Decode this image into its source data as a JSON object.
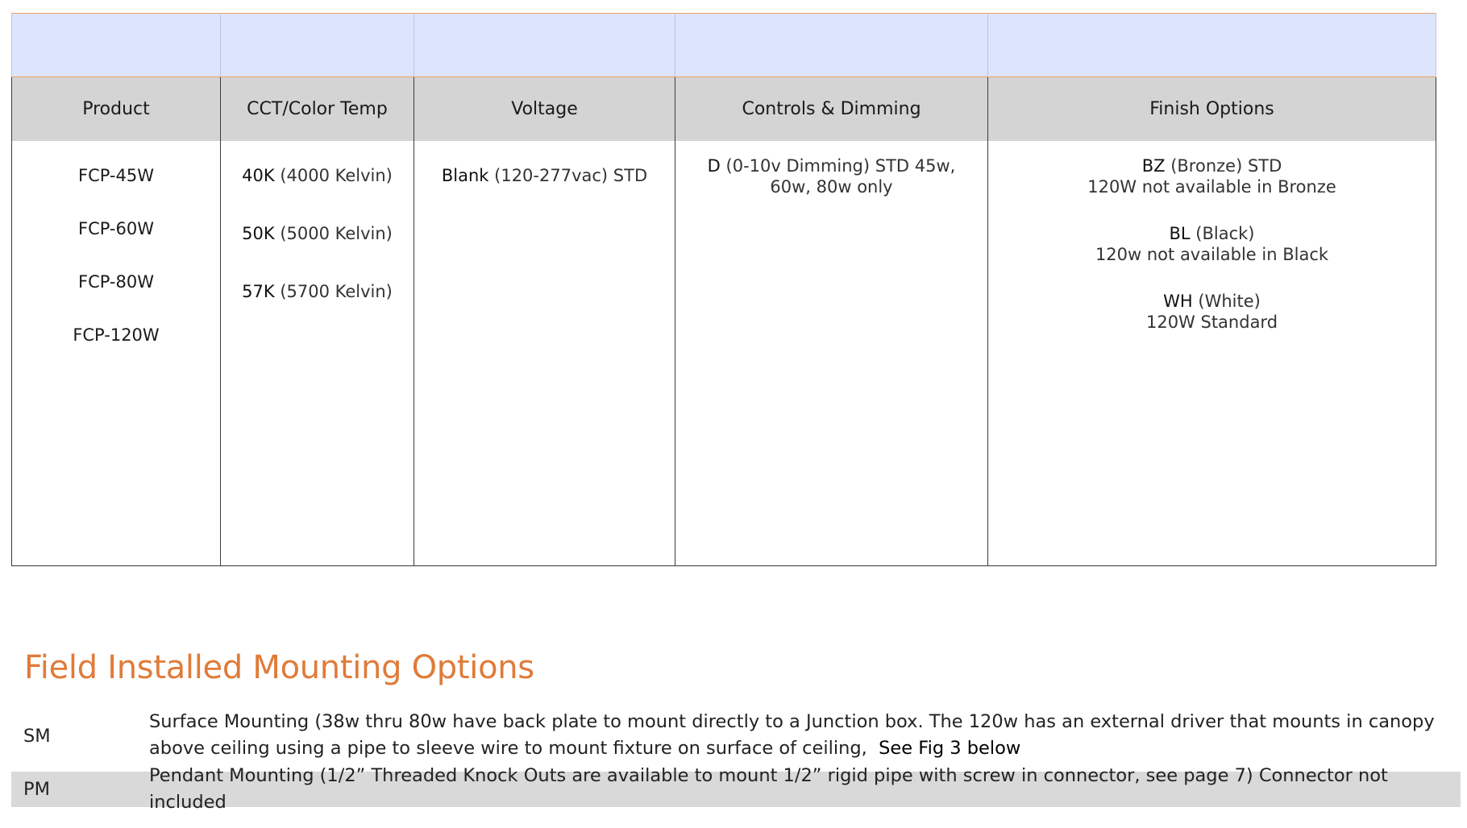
{
  "table": {
    "headers": [
      "Product",
      "CCT/Color Temp",
      "Voltage",
      "Controls & Dimming",
      "Finish Options"
    ],
    "products": [
      "FCP-45W",
      "FCP-60W",
      "FCP-80W",
      "FCP-120W"
    ],
    "cct": [
      {
        "code": "40K",
        "desc": "(4000 Kelvin)"
      },
      {
        "code": "50K",
        "desc": "(5000 Kelvin)"
      },
      {
        "code": "57K",
        "desc": "(5700 Kelvin)"
      }
    ],
    "voltage": {
      "code": "Blank",
      "desc": "(120-277vac) STD"
    },
    "controls": {
      "code": "D",
      "desc_line1": "(0-10v Dimming) STD 45w,",
      "desc_line2": "60w, 80w only"
    },
    "finish": [
      {
        "code": "BZ",
        "desc": "(Bronze) STD",
        "note": "120W not available in Bronze"
      },
      {
        "code": "BL",
        "desc": "(Black)",
        "note": "120w not available in Black"
      },
      {
        "code": "WH",
        "desc": "(White)",
        "note": "120W Standard"
      }
    ]
  },
  "mounting": {
    "title": "Field Installed Mounting Options",
    "options": [
      {
        "code": "SM",
        "text": "Surface Mounting (38w thru 80w have back plate to mount directly to a Junction box. The 120w has an external driver that mounts in canopy above ceiling using a pipe to sleeve wire to mount fixture on surface of ceiling,",
        "link": "See Fig 3 below"
      },
      {
        "code": "PM",
        "text": "Pendant Mounting (1/2” Threaded Knock Outs are available to mount 1/2” rigid pipe with screw in connector, see page 7) Connector not included"
      }
    ]
  }
}
